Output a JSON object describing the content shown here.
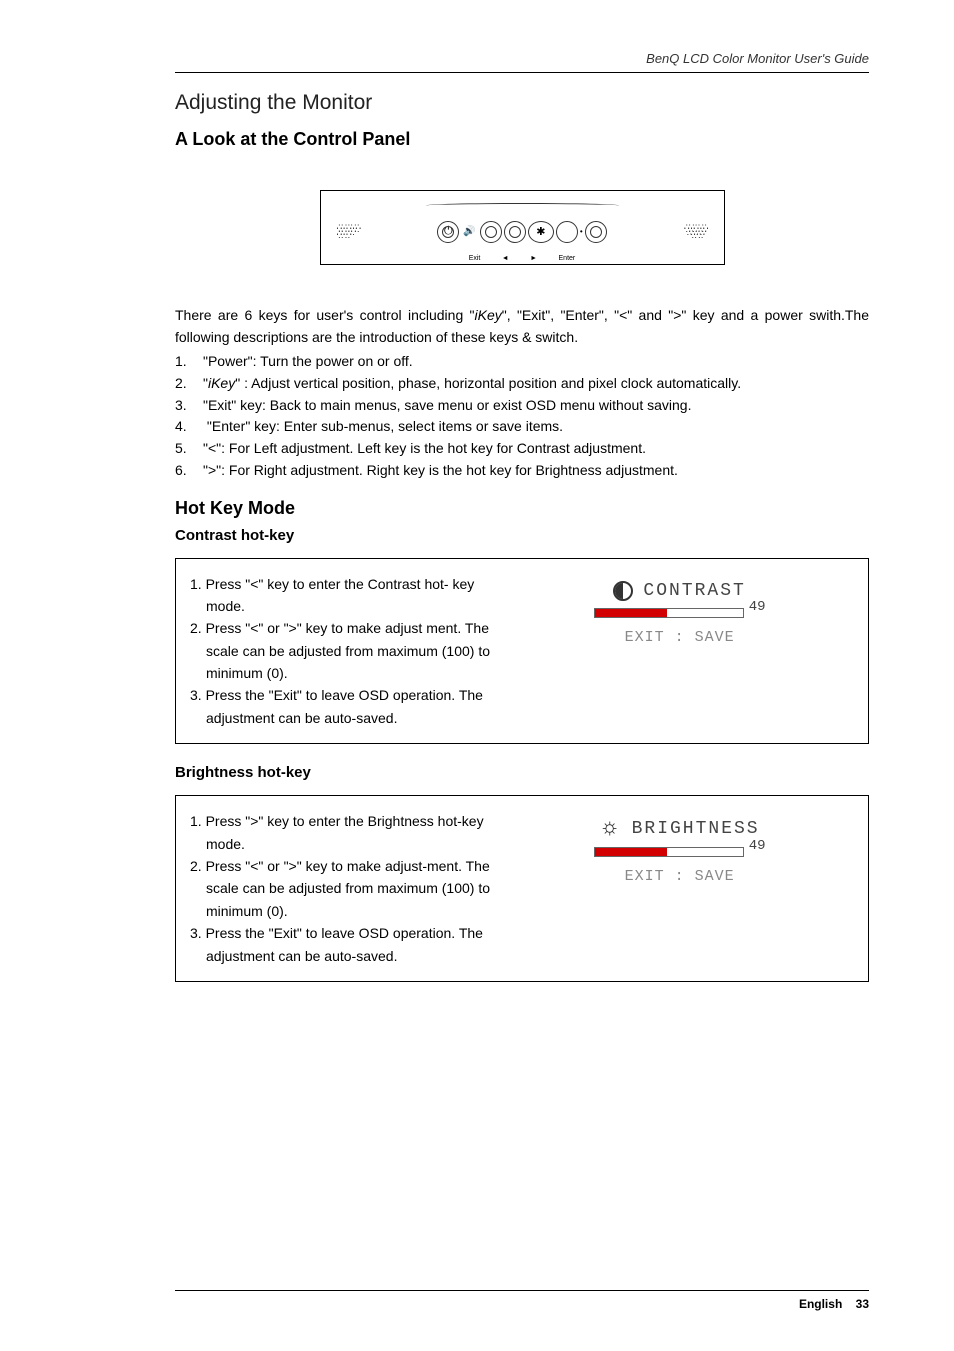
{
  "header": {
    "text": "BenQ LCD Color Monitor User's Guide"
  },
  "title": "Adjusting the Monitor",
  "section1": {
    "heading": "A Look at the Control Panel",
    "diagram_labels": {
      "exit": "Exit",
      "left": "◄",
      "right": "►",
      "enter": "Enter"
    },
    "intro_p1a": "There are 6 keys for user's control including \"",
    "intro_p1_ikey": "iKey",
    "intro_p1b": "\", \"Exit\", \"Enter\", \"",
    "intro_p1_lt": "<",
    "intro_p1c": "\" and \"",
    "intro_p1_gt": ">",
    "intro_p1d": "\" key and a power swith.The following descriptions are the introduction of these keys & switch.",
    "items": [
      {
        "num": "1.",
        "text": "\"Power\": Turn the power on or off."
      },
      {
        "num": "2.",
        "text_a": "\"",
        "text_i": "iKey",
        "text_b": "\" : Adjust vertical position, phase, horizontal position and pixel clock automatically."
      },
      {
        "num": "3.",
        "text": "\"Exit\" key: Back to main menus,  save menu or exist OSD menu without saving."
      },
      {
        "num": "4.",
        "text": " \"Enter\" key: Enter  sub-menus, select items or save items."
      },
      {
        "num": "5.",
        "text": "\"<\": For Left adjustment. Left key is the hot key for Contrast adjustment."
      },
      {
        "num": "6.",
        "text": "\">\": For Right adjustment. Right key is the hot key for Brightness adjustment."
      }
    ]
  },
  "section2": {
    "heading": "Hot Key Mode",
    "contrast": {
      "heading": "Contrast hot-key",
      "steps": [
        "1. Press \"<\" key to enter the Contrast hot-  key mode.",
        "2. Press \"<\"  or  \">\" key to make adjust ment. The scale can be adjusted from maximum (100) to minimum (0).",
        "3. Press the \"Exit\" to leave OSD operation. The adjustment can be auto-saved."
      ],
      "osd": {
        "title": "CONTRAST",
        "value": "49",
        "exit": "EXIT : SAVE"
      }
    },
    "brightness": {
      "heading": "Brightness hot-key",
      "steps": [
        "1. Press \">\" key to enter the Brightness hot-key mode.",
        "2. Press \"<\" or \">\" key to make adjust-ment. The scale can be adjusted from maximum (100) to minimum (0).",
        "3. Press the \"Exit\" to leave OSD operation. The adjustment can be auto-saved."
      ],
      "osd": {
        "title": "BRIGHTNESS",
        "value": "49",
        "exit": "EXIT : SAVE"
      }
    }
  },
  "footer": {
    "lang": "English",
    "page": "33"
  }
}
